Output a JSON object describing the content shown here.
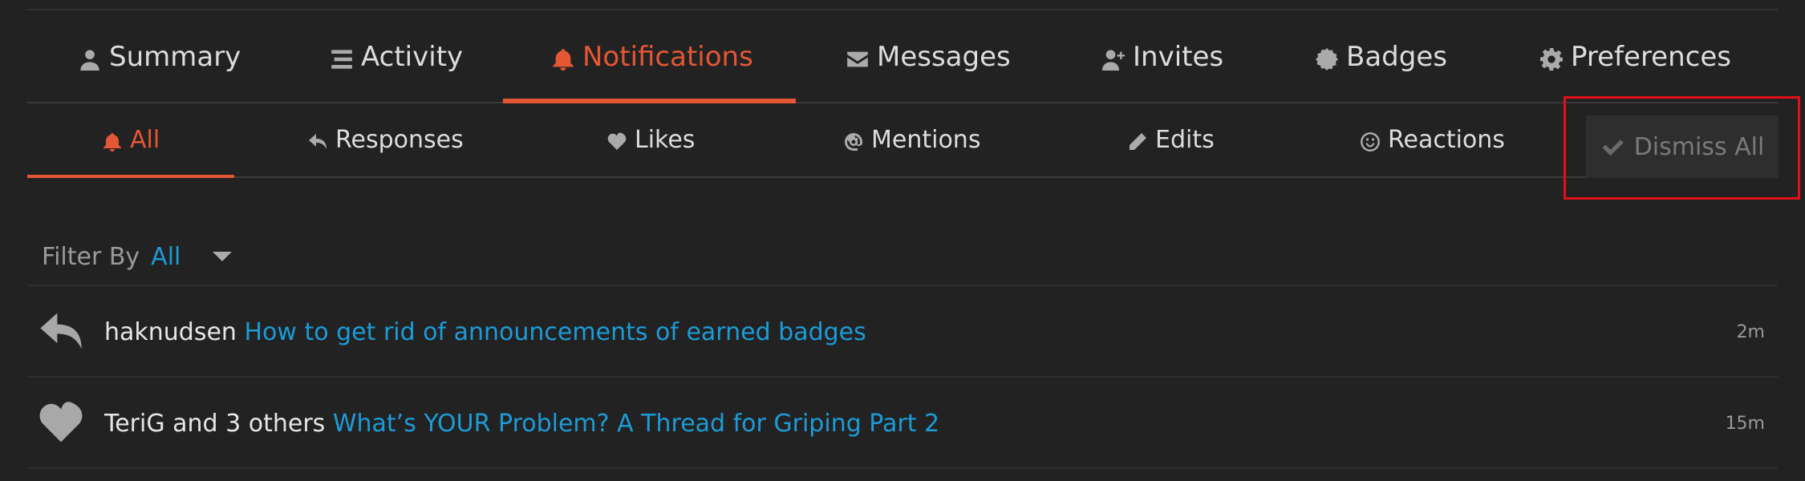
{
  "main_tabs": [
    {
      "label": "Summary",
      "icon": "user-icon"
    },
    {
      "label": "Activity",
      "icon": "stream-icon"
    },
    {
      "label": "Notifications",
      "icon": "bell-icon",
      "active": true
    },
    {
      "label": "Messages",
      "icon": "envelope-icon"
    },
    {
      "label": "Invites",
      "icon": "user-plus-icon"
    },
    {
      "label": "Badges",
      "icon": "certificate-icon"
    },
    {
      "label": "Preferences",
      "icon": "gear-icon"
    }
  ],
  "sub_tabs": [
    {
      "label": "All",
      "icon": "bell-icon",
      "active": true
    },
    {
      "label": "Responses",
      "icon": "reply-icon"
    },
    {
      "label": "Likes",
      "icon": "heart-icon"
    },
    {
      "label": "Mentions",
      "icon": "at-icon"
    },
    {
      "label": "Edits",
      "icon": "pencil-icon"
    },
    {
      "label": "Reactions",
      "icon": "smile-icon"
    }
  ],
  "dismiss_all": {
    "label": "Dismiss All",
    "icon": "check-icon"
  },
  "filter": {
    "label": "Filter By",
    "value": "All"
  },
  "notifications": [
    {
      "icon": "reply-icon",
      "user": "haknudsen",
      "title": "How to get rid of announcements of earned badges",
      "time": "2m"
    },
    {
      "icon": "heart-icon",
      "user": "TeriG and 3 others",
      "title": "What’s YOUR Problem? A Thread for Griping Part 2",
      "time": "15m"
    }
  ],
  "colors": {
    "background": "#222222",
    "accent": "#e45735",
    "link": "#1d9bd7",
    "highlight_outline": "#e3101c"
  }
}
